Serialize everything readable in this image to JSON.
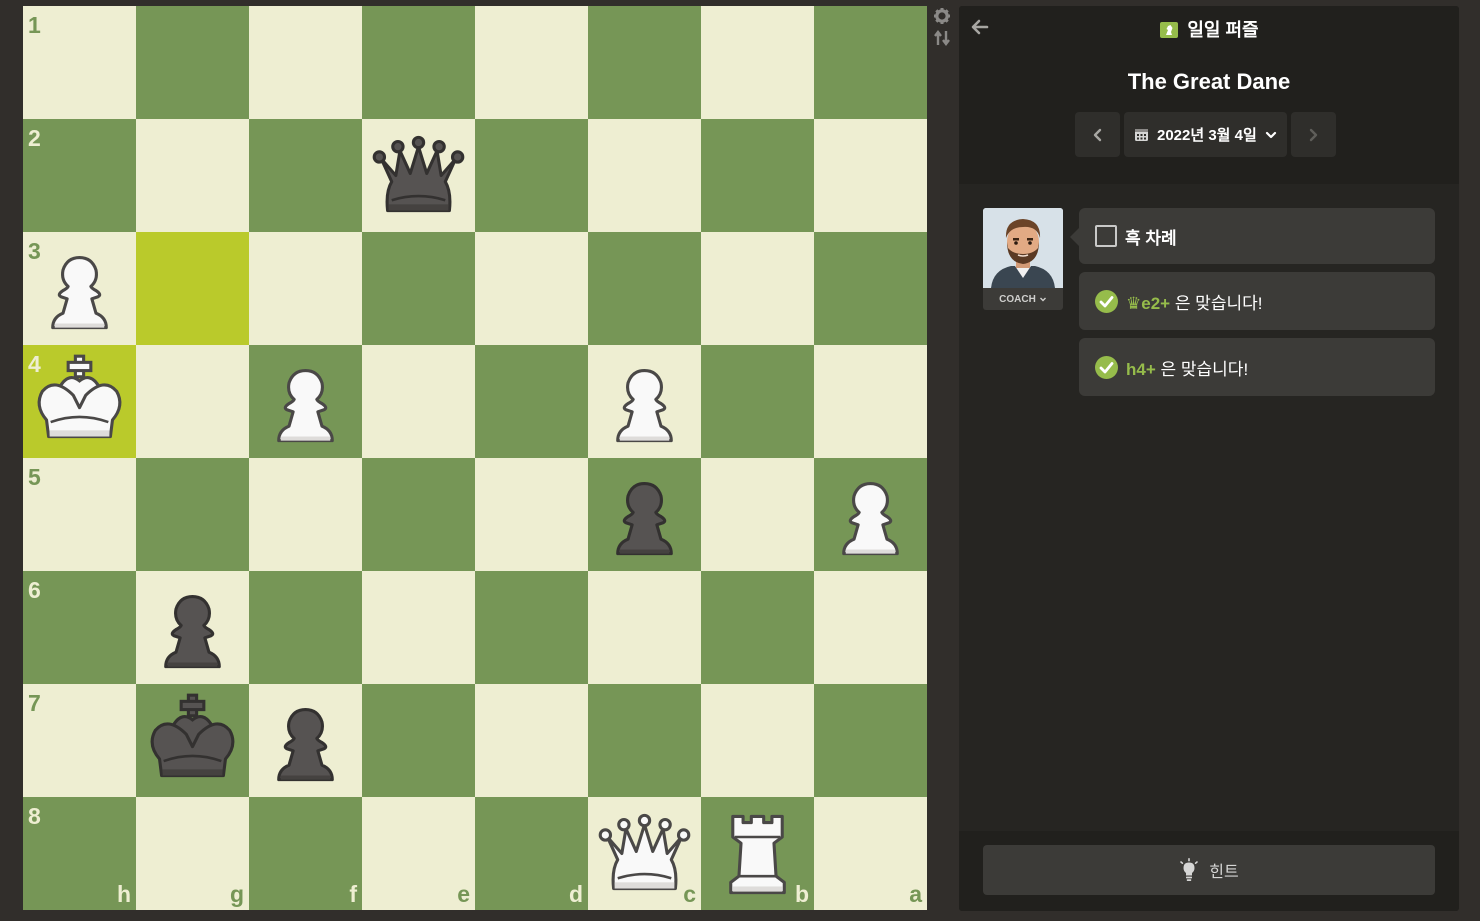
{
  "board": {
    "ranks": [
      "1",
      "2",
      "3",
      "4",
      "5",
      "6",
      "7",
      "8"
    ],
    "files": [
      "h",
      "g",
      "f",
      "e",
      "d",
      "c",
      "b",
      "a"
    ],
    "highlight": [
      "g3",
      "h4"
    ],
    "pieces": [
      {
        "square": "e2",
        "type": "queen",
        "color": "black"
      },
      {
        "square": "h3",
        "type": "pawn",
        "color": "white"
      },
      {
        "square": "h4",
        "type": "king",
        "color": "white"
      },
      {
        "square": "f4",
        "type": "pawn",
        "color": "white"
      },
      {
        "square": "c4",
        "type": "pawn",
        "color": "white"
      },
      {
        "square": "c5",
        "type": "pawn",
        "color": "black"
      },
      {
        "square": "a5",
        "type": "pawn",
        "color": "white"
      },
      {
        "square": "g6",
        "type": "pawn",
        "color": "black"
      },
      {
        "square": "g7",
        "type": "king",
        "color": "black"
      },
      {
        "square": "f7",
        "type": "pawn",
        "color": "black"
      },
      {
        "square": "c8",
        "type": "queen",
        "color": "white"
      },
      {
        "square": "b8",
        "type": "rook",
        "color": "white"
      }
    ],
    "colors": {
      "light": "#eeeed2",
      "dark": "#769656",
      "highlight": "#baca2b"
    }
  },
  "controls": {
    "settings_icon": "gear-icon",
    "flip_icon": "flip-board-icon"
  },
  "panel": {
    "back_icon": "arrow-left-icon",
    "header_icon": "daily-puzzle-icon",
    "header_label": "일일 퍼즐",
    "title": "The Great Dane",
    "date": "2022년 3월 4일",
    "prev_icon": "chevron-left-icon",
    "next_icon": "chevron-right-icon",
    "calendar_icon": "calendar-icon"
  },
  "coach": {
    "label": "COACH"
  },
  "messages": {
    "turn": "흑 차례",
    "correct1_move": "♛e2+",
    "correct1_text": "은 맞습니다!",
    "correct2_move": "h4+",
    "correct2_text": "은 맞습니다!"
  },
  "hint": {
    "label": "힌트",
    "icon": "lightbulb-icon"
  },
  "accent": "#96bc4b"
}
